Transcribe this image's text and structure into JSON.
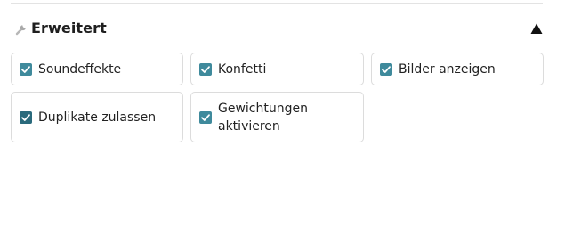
{
  "section": {
    "title": "Erweitert",
    "icon": "wrench-icon",
    "toggle_icon": "triangle-up-icon",
    "expanded": true
  },
  "colors": {
    "checkbox_fill": "#3f8a9c",
    "checkbox_fill_focused": "#2a6a7c",
    "border": "#dcdcdc",
    "title": "#1f1f1f"
  },
  "options": [
    {
      "label": "Soundeffekte",
      "checked": true
    },
    {
      "label": "Konfetti",
      "checked": true
    },
    {
      "label": "Bilder anzeigen",
      "checked": true
    },
    {
      "label": "Duplikate zulassen",
      "checked": true
    },
    {
      "label": "Gewichtungen aktivieren",
      "checked": true
    }
  ]
}
